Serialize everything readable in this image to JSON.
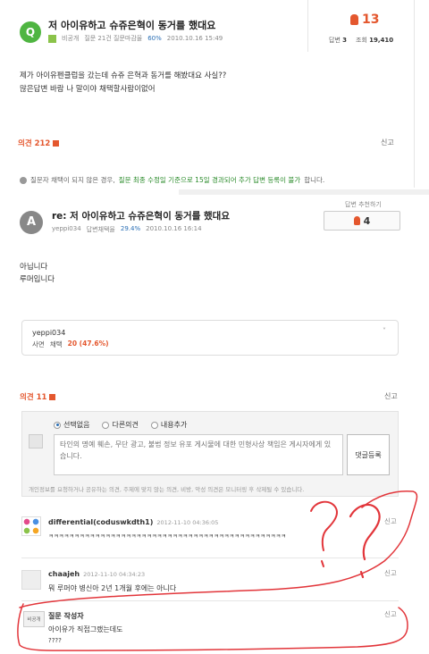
{
  "question": {
    "badge": "Q",
    "title": "저 아이유하고 슈쥬은혁이 동거를 했대요",
    "author": "비공개",
    "meta_questions": "질문 21건 질문마감율",
    "meta_rate": "60%",
    "meta_date": "2010.10.16 15:49",
    "likes": "13",
    "answers_label": "답변",
    "answers_count": "3",
    "views_label": "조회",
    "views_count": "19,410",
    "body_line1": "제가 아이유펜클럽을 갔는데 슈쥬 은혁과 동거를 해봤대요 사실??",
    "body_line2": "많은답변 바람 나 말이야 채택할사람이없어",
    "opinion_label": "의견 212",
    "report_label": "신고",
    "notice_pre": "질문자 채택이 되지 않은 경우,",
    "notice_highlight": "질문 최종 수정일 기준으로 15일 경과되어 추가 답변 등록이 불가",
    "notice_post": "합니다."
  },
  "answer": {
    "badge": "A",
    "title": "re: 저 아이유하고 슈쥬은혁이 동거를 했대요",
    "author": "yeppi034",
    "meta_label": "답변채택율",
    "meta_rate": "29.4%",
    "meta_date": "2010.10.16 16:14",
    "recommend_label": "답변 추천하기",
    "recommend_count": "4",
    "body_line1": "아닙니다",
    "body_line2": "루머입니다"
  },
  "profile": {
    "name": "yeppi034",
    "rank": "사면",
    "adopt_label": "채택",
    "adopt_value": "20 (47.6%)",
    "chevron": "˅"
  },
  "comments_section": {
    "opinion_label": "의견 11",
    "report_label": "신고",
    "radio_options": [
      "선택없음",
      "다른의견",
      "내용추가"
    ],
    "textarea_placeholder": "타인의 명예 훼손, 무단 광고, 불법 정보 유포 게시물에 대한 민형사상 책임은 게시자에게 있습니다.",
    "submit_label": "댓글등록",
    "notice": "개인정보를 요청하거나 공유하는 의견, 주제에 맞지 않는 의견, 비방, 악성 의견은 모니터링 후 삭제될 수 있습니다."
  },
  "comments": [
    {
      "author": "differential(coduswkdth1)",
      "date": "2012-11-10 04:36:05",
      "text": "ㅋㅋㅋㅋㅋㅋㅋㅋㅋㅋㅋㅋㅋㅋㅋㅋㅋㅋㅋㅋㅋㅋㅋㅋㅋㅋㅋㅋㅋㅋㅋㅋㅋㅋㅋㅋㅋㅋㅋㅋㅋㅋㅋㅋㅋㅋ",
      "report": "신고"
    },
    {
      "author": "chaajeh",
      "date": "2012-11-10 04:34:23",
      "text": "뭐 루머야 병신아 2년 1개월 후에는 아니다",
      "report": "신고"
    },
    {
      "badge": "비공개",
      "author": "질문 작성자",
      "text_line1": "아이유가 직접그랬는데도",
      "text_line2": "????",
      "report": "신고"
    }
  ],
  "colors": {
    "accent_orange": "#e4572e",
    "q_green": "#4fb541",
    "scribble_red": "#e2353a"
  }
}
